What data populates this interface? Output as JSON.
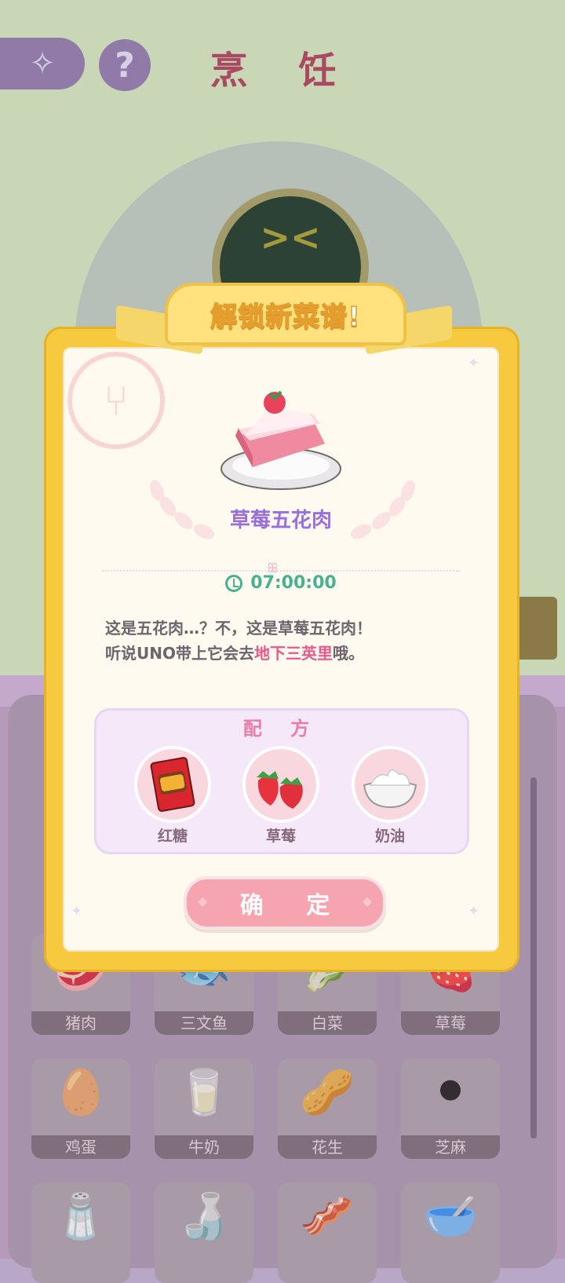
{
  "background": {
    "title": "烹 饪",
    "ingredient_grid": [
      {
        "label": "猪肉",
        "icon": "🥩"
      },
      {
        "label": "三文鱼",
        "icon": "🐟"
      },
      {
        "label": "白菜",
        "icon": "🥬"
      },
      {
        "label": "草莓",
        "icon": "🍓"
      },
      {
        "label": "鸡蛋",
        "icon": "🥚"
      },
      {
        "label": "牛奶",
        "icon": "🥛"
      },
      {
        "label": "花生",
        "icon": "🥜"
      },
      {
        "label": "芝麻",
        "icon": "⚫"
      },
      {
        "label": "",
        "icon": "🧂"
      },
      {
        "label": "",
        "icon": "🍶"
      },
      {
        "label": "",
        "icon": "🥓"
      },
      {
        "label": "",
        "icon": "🥣"
      }
    ]
  },
  "modal": {
    "banner": "解锁新菜谱!",
    "dish_name": "草莓五花肉",
    "cook_time": "07:00:00",
    "description": {
      "line1": "这是五花肉…？不，这是草莓五花肉！",
      "line2_prefix": "听说UNO带上它会去",
      "line2_highlight": "地下三英里",
      "line2_suffix": "哦。"
    },
    "recipe_title": "配 方",
    "ingredients": [
      {
        "name": "红糖",
        "icon": "brown-sugar"
      },
      {
        "name": "草莓",
        "icon": "strawberry"
      },
      {
        "name": "奶油",
        "icon": "cream"
      }
    ],
    "confirm_label": "确 定"
  },
  "colors": {
    "frame": "#f6c93e",
    "dish_name": "#9b6ee0",
    "timer": "#46b28f",
    "highlight": "#e8598a",
    "recipe_title": "#ee7ba5",
    "confirm": "#f7a4b1"
  }
}
